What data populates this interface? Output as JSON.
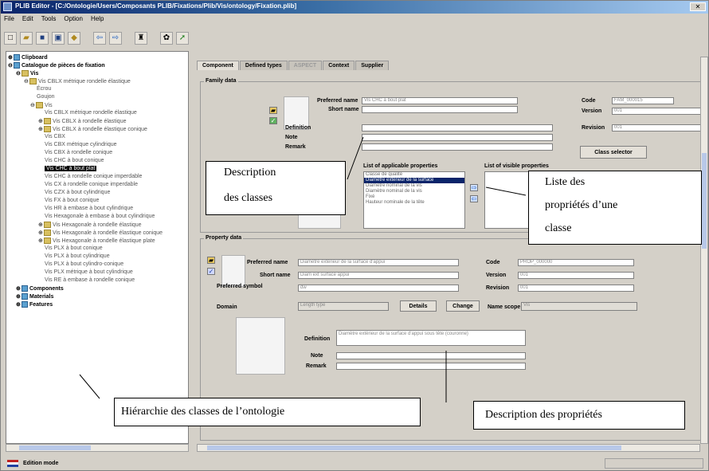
{
  "window": {
    "title": "PLIB Editor - [C:/Ontologie/Users/Composants PLIB/Fixations/Plib/Vis/ontology/Fixation.plib]"
  },
  "menu": [
    "File",
    "Edit",
    "Tools",
    "Option",
    "Help"
  ],
  "toolbar_icons": [
    "new-icon",
    "open-icon",
    "save-icon",
    "save-as-icon",
    "export-icon",
    "back-icon",
    "forward-icon",
    "find-icon",
    "filter-icon",
    "navigate-icon"
  ],
  "tree": {
    "root": "Clipboard",
    "catalog": "Catalogue de pièces de fixation",
    "items": [
      "Vis",
      "Vis CBLX métrique rondelle élastique",
      "Écrou",
      "Goujon",
      "Vis",
      "Vis CBLX métrique rondelle élastique",
      "Vis CBLX à rondelle élastique",
      "Vis CBLX à rondelle élastique conique",
      "Vis CBX",
      "Vis CBX métrique cylindrique",
      "Vis CBX à rondelle conique",
      "Vis CHC à bout conique",
      "Vis CHC à bout plat",
      "Vis CHC à rondelle conique imperdable",
      "Vis CX à rondelle conique imperdable",
      "Vis CZX à bout cylindrique",
      "Vis FX à bout conique",
      "Vis HR à embase à bout cylindrique",
      "Vis Hexagonale à embase à bout cylindrique",
      "Vis Hexagonale à rondelle élastique",
      "Vis Hexagonale à rondelle élastique conique",
      "Vis Hexagonale à rondelle élastique plate",
      "Vis PLX à bout conique",
      "Vis PLX à bout cylindrique",
      "Vis PLX à bout cylindro-conique",
      "Vis PLX métrique à bout cylindrique",
      "Vis RE à embase à rondelle conique",
      "Components",
      "Materials",
      "Features"
    ],
    "selected": "Vis CHC à bout plat"
  },
  "tabs": [
    "Component",
    "Defined types",
    "ASPECT",
    "Context",
    "Supplier"
  ],
  "family_data": {
    "section_title": "Family data",
    "preferred_name_label": "Preferred name",
    "preferred_name": "Vis CHC à bout plat",
    "short_name_label": "Short name",
    "short_name": "",
    "definition_label": "Definition",
    "definition": "",
    "note_label": "Note",
    "note": "",
    "remark_label": "Remark",
    "remark": "",
    "code_label": "Code",
    "code": "FAM_000015",
    "version_label": "Version",
    "version": "001",
    "revision_label": "Revision",
    "revision": "001",
    "class_selector_label": "Class selector",
    "applicable_props_label": "List of applicable properties",
    "applicable_props": [
      "Classe de qualité",
      "Diamètre extérieur de la surface",
      "Diamètre nominal de la vis",
      "Diamètre nominal de la vis",
      "Fixé",
      "Hauteur nominale de la tête"
    ],
    "applicable_selected": "Diamètre extérieur de la surface",
    "visible_props_label": "List of visible properties",
    "visible_props": []
  },
  "property_data": {
    "section_title": "Property data",
    "preferred_name_label": "Preferred name",
    "preferred_name": "Diamètre extérieur de la surface d'appui",
    "short_name_label": "Short name",
    "short_name": "Diam ext surface appui",
    "symbol_label": "Preferred symbol",
    "symbol": "dw",
    "domain_label": "Domain",
    "domain": "Length type",
    "details_label": "Details",
    "change_label": "Change",
    "name_scope_label": "Name scope",
    "name_scope": "Vis",
    "code_label": "Code",
    "code": "PROP_000000",
    "version_label": "Version",
    "version": "001",
    "revision_label": "Revision",
    "revision": "001",
    "definition_label": "Definition",
    "definition": "Diamètre extérieur de la surface d'appui sous tête (couronne)",
    "note_label": "Note",
    "note": "",
    "remark_label": "Remark",
    "remark": ""
  },
  "status": {
    "mode": "Edition mode"
  },
  "callouts": {
    "description_classes": [
      "Description",
      "des classes"
    ],
    "liste_proprietes": [
      "Liste des",
      "propriétés d’une",
      "classe"
    ],
    "hierarchie": "Hiérarchie des classes de l’ontologie",
    "description_proprietes": "Description des propriétés"
  }
}
